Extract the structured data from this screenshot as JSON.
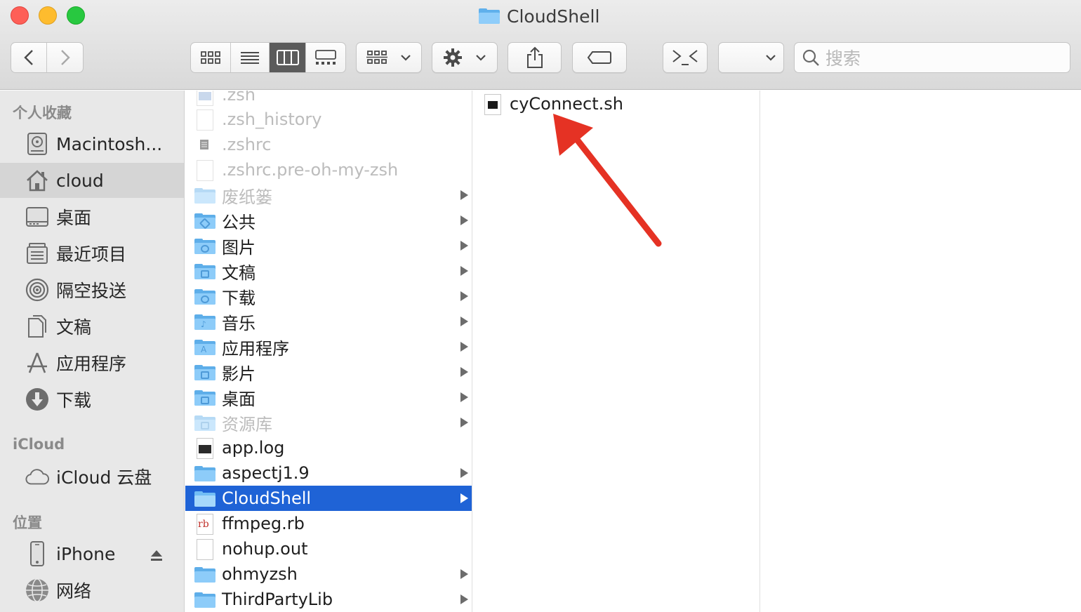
{
  "window": {
    "title": "CloudShell"
  },
  "toolbar": {
    "search_placeholder": "搜索",
    "icons": [
      "chevron-left-icon",
      "chevron-right-icon",
      "icon-view-icon",
      "list-view-icon",
      "column-view-icon",
      "gallery-view-icon",
      "group-icon",
      "gear-icon",
      "share-icon",
      "tag-icon",
      "terminal-icon",
      "dropdown-icon",
      "search-icon"
    ]
  },
  "sidebar": {
    "sections": [
      {
        "title": "个人收藏",
        "items": [
          {
            "label": "Macintosh...",
            "icon": "hard-disk-icon"
          },
          {
            "label": "cloud",
            "icon": "home-icon",
            "selected": true
          },
          {
            "label": "桌面",
            "icon": "desktop-icon"
          },
          {
            "label": "最近项目",
            "icon": "recents-icon"
          },
          {
            "label": "隔空投送",
            "icon": "airdrop-icon"
          },
          {
            "label": "文稿",
            "icon": "documents-icon"
          },
          {
            "label": "应用程序",
            "icon": "applications-icon"
          },
          {
            "label": "下载",
            "icon": "downloads-icon"
          }
        ]
      },
      {
        "title": "iCloud",
        "items": [
          {
            "label": "iCloud 云盘",
            "icon": "cloud-icon"
          }
        ]
      },
      {
        "title": "位置",
        "items": [
          {
            "label": "iPhone",
            "icon": "iphone-icon"
          },
          {
            "label": "网络",
            "icon": "network-icon"
          }
        ]
      }
    ]
  },
  "column1": {
    "items": [
      {
        "name": ".zsh",
        "kind": "file",
        "dim": true
      },
      {
        "name": ".zsh_history",
        "kind": "file",
        "dim": true
      },
      {
        "name": ".zshrc",
        "kind": "file",
        "dim": true
      },
      {
        "name": ".zshrc.pre-oh-my-zsh",
        "kind": "file",
        "dim": true
      },
      {
        "name": "废纸篓",
        "kind": "folder",
        "dim": true
      },
      {
        "name": "公共",
        "kind": "folder"
      },
      {
        "name": "图片",
        "kind": "folder"
      },
      {
        "name": "文稿",
        "kind": "folder"
      },
      {
        "name": "下载",
        "kind": "folder"
      },
      {
        "name": "音乐",
        "kind": "folder"
      },
      {
        "name": "应用程序",
        "kind": "folder"
      },
      {
        "name": "影片",
        "kind": "folder"
      },
      {
        "name": "桌面",
        "kind": "folder"
      },
      {
        "name": "资源库",
        "kind": "folder",
        "dim": true
      },
      {
        "name": "app.log",
        "kind": "file"
      },
      {
        "name": "aspectj1.9",
        "kind": "folder"
      },
      {
        "name": "CloudShell",
        "kind": "folder",
        "selected": true
      },
      {
        "name": "ffmpeg.rb",
        "kind": "file"
      },
      {
        "name": "nohup.out",
        "kind": "file"
      },
      {
        "name": "ohmyzsh",
        "kind": "folder"
      },
      {
        "name": "ThirdPartyLib",
        "kind": "folder"
      }
    ]
  },
  "column2": {
    "items": [
      {
        "name": "cyConnect.sh",
        "kind": "file"
      }
    ]
  },
  "colors": {
    "selection": "#1f63d6",
    "annotation_arrow": "#e53224",
    "sidebar_bg": "#e8e8e8",
    "folder": "#5eaee9"
  }
}
